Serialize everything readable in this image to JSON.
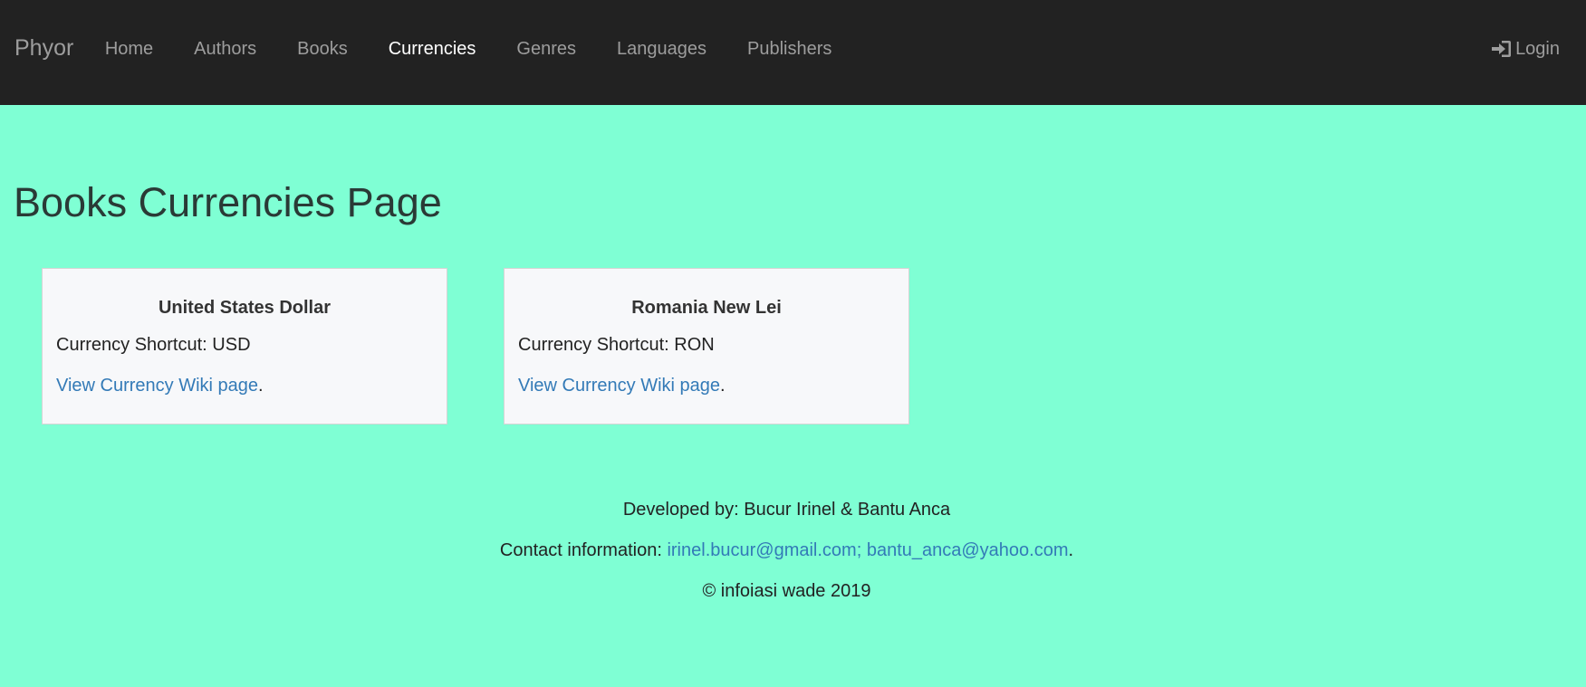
{
  "navbar": {
    "brand": "Phyor",
    "items": [
      {
        "label": "Home"
      },
      {
        "label": "Authors"
      },
      {
        "label": "Books"
      },
      {
        "label": "Currencies"
      },
      {
        "label": "Genres"
      },
      {
        "label": "Languages"
      },
      {
        "label": "Publishers"
      }
    ],
    "active": "Currencies",
    "login_label": "Login",
    "login_icon": "sign-in-icon"
  },
  "main": {
    "title": "Books Currencies Page",
    "cards": [
      {
        "name": "United States Dollar",
        "shortcut_label": "Currency Shortcut: USD",
        "link_label": "View Currency Wiki page",
        "link_suffix": "."
      },
      {
        "name": "Romania New Lei",
        "shortcut_label": "Currency Shortcut: RON",
        "link_label": "View Currency Wiki page",
        "link_suffix": "."
      }
    ]
  },
  "footer": {
    "developed_by": "Developed by: Bucur Irinel & Bantu Anca",
    "contact_prefix": "Contact information: ",
    "contact_emails": "irinel.bucur@gmail.com; bantu_anca@yahoo.com",
    "contact_suffix": ".",
    "copyright": "© infoiasi wade 2019"
  },
  "colors": {
    "background": "#7fffd4",
    "navbar": "#222222",
    "link": "#337ab7",
    "nav_inactive": "#9d9d9d",
    "nav_active": "#ffffff"
  }
}
